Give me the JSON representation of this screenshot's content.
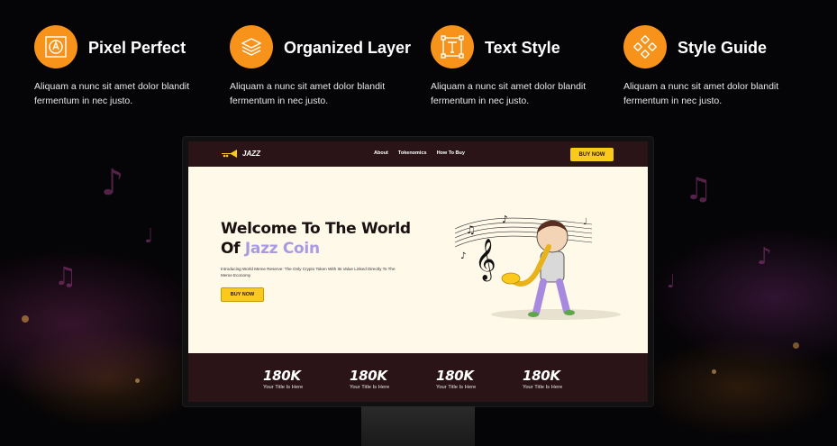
{
  "features": [
    {
      "icon": "pixel-perfect-icon",
      "title": "Pixel Perfect",
      "desc": "Aliquam a nunc sit amet dolor blandit fermentum in nec justo."
    },
    {
      "icon": "layers-icon",
      "title": "Organized Layer",
      "desc": "Aliquam a nunc sit amet dolor blandit fermentum in nec justo."
    },
    {
      "icon": "text-style-icon",
      "title": "Text Style",
      "desc": "Aliquam a nunc sit amet dolor blandit fermentum in nec justo."
    },
    {
      "icon": "style-guide-icon",
      "title": "Style Guide",
      "desc": "Aliquam a nunc sit amet dolor blandit fermentum in nec justo."
    }
  ],
  "site": {
    "logo_text": "JAZZ",
    "nav": [
      "About",
      "Tokenomics",
      "How To Buy"
    ],
    "buy_button": "BUY NOW",
    "hero": {
      "title_line1": "Welcome To The World",
      "title_line2_prefix": "Of ",
      "title_line2_accent": "Jazz Coin",
      "subtitle": "Introducing World Meme Reserve: The Only Crypto Token With Its Value Linked Directly To The Meme Economy",
      "button": "BUY NOW"
    },
    "stats": [
      {
        "value": "180K",
        "label": "Your Title Is Here"
      },
      {
        "value": "180K",
        "label": "Your Title Is Here"
      },
      {
        "value": "180K",
        "label": "Your Title Is Here"
      },
      {
        "value": "180K",
        "label": "Your Title Is Here"
      }
    ]
  },
  "colors": {
    "accent": "#F7931A",
    "site_dark": "#2A1418",
    "site_yellow": "#F9C91C",
    "hero_bg": "#FFF9EA",
    "hero_accent": "#A89BE2"
  }
}
